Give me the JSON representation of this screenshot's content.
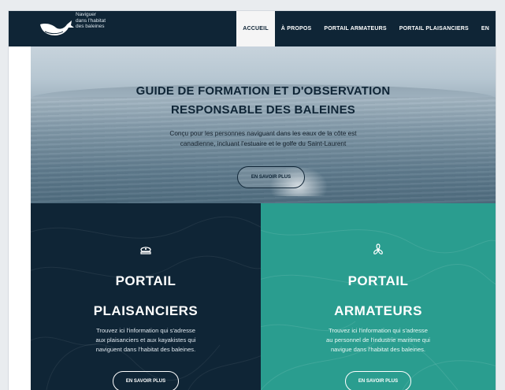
{
  "brand": {
    "lines": [
      "Naviguer",
      "dans l'habitat",
      "des baleines"
    ],
    "icon": "whale-logo"
  },
  "nav": {
    "items": [
      {
        "label": "ACCUEIL",
        "active": true
      },
      {
        "label": "À PROPOS",
        "active": false
      },
      {
        "label": "PORTAIL ARMATEURS",
        "active": false
      },
      {
        "label": "PORTAIL PLAISANCIERS",
        "active": false
      },
      {
        "label": "EN",
        "active": false
      }
    ]
  },
  "hero": {
    "title_line1": "GUIDE DE FORMATION ET D'OBSERVATION",
    "title_line2": "RESPONSABLE DES BALEINES",
    "subtitle_line1": "Conçu pour les personnes naviguant dans les eaux de la côte est",
    "subtitle_line2": "canadienne, incluant l'estuaire et le golfe du Saint-Laurent",
    "button": "EN SAVOIR PLUS"
  },
  "portals": {
    "plaisanciers": {
      "icon": "captain-hat-icon",
      "title_line1": "PORTAIL",
      "title_line2": "PLAISANCIERS",
      "desc_line1": "Trouvez ici l'information qui s'adresse",
      "desc_line2": "aux plaisanciers et aux kayakistes qui",
      "desc_line3": "naviguent dans l'habitat des baleines.",
      "button": "EN SAVOIR PLUS",
      "color": "#0f2536"
    },
    "armateurs": {
      "icon": "propeller-icon",
      "title_line1": "PORTAIL",
      "title_line2": "ARMATEURS",
      "desc_line1": "Trouvez ici l'information qui s'adresse",
      "desc_line2": "au personnel de l'industrie maritime qui",
      "desc_line3": "navigue dans l'habitat des baleines.",
      "button": "EN SAVOIR PLUS",
      "color": "#2a9d8f"
    }
  }
}
